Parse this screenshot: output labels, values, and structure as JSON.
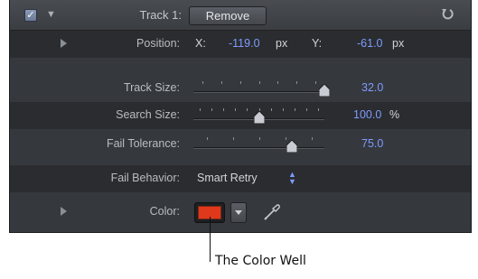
{
  "header": {
    "checkbox_checked": true,
    "track_label": "Track 1:",
    "remove_label": "Remove",
    "reset_icon": "reset-arrow-icon"
  },
  "position": {
    "label": "Position:",
    "x_label": "X:",
    "x_value": "-119.0",
    "x_unit": "px",
    "y_label": "Y:",
    "y_value": "-61.0",
    "y_unit": "px"
  },
  "track_size": {
    "label": "Track Size:",
    "value": "32.0",
    "level": 1.0
  },
  "search_size": {
    "label": "Search Size:",
    "value": "100.0",
    "unit": "%",
    "level": 0.5
  },
  "fail_tolerance": {
    "label": "Fail Tolerance:",
    "value": "75.0",
    "level": 0.75
  },
  "fail_behavior": {
    "label": "Fail Behavior:",
    "value": "Smart Retry"
  },
  "color": {
    "label": "Color:",
    "swatch": "#e0381b",
    "eyedropper_icon": "eyedropper-icon"
  },
  "callout": {
    "text": "The Color Well"
  },
  "colors": {
    "value_blue": "#7f9bff",
    "panel": "#35383c"
  }
}
